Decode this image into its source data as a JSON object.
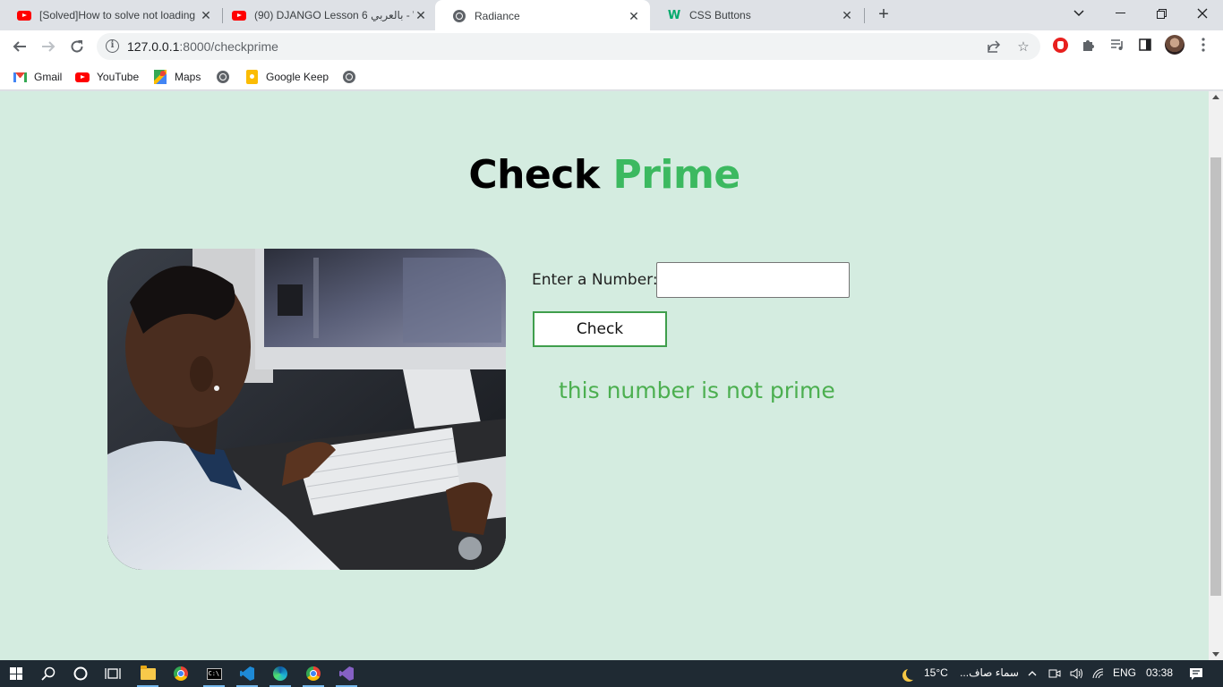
{
  "browser": {
    "tabs": [
      {
        "title": "[Solved]How to solve not loading",
        "favicon": "youtube-icon",
        "active": false
      },
      {
        "title": "(90) DJANGO Lesson 6 بالعربي - \\",
        "favicon": "youtube-icon",
        "active": false
      },
      {
        "title": "Radiance",
        "favicon": "globe-icon",
        "active": true
      },
      {
        "title": "CSS Buttons",
        "favicon": "w3schools-icon",
        "active": false
      }
    ],
    "new_tab_label": "+",
    "url_host": "127.0.0.1",
    "url_path": ":8000/checkprime",
    "bookmarks": [
      {
        "label": "Gmail",
        "icon": "gmail-icon"
      },
      {
        "label": "YouTube",
        "icon": "youtube-icon"
      },
      {
        "label": "Maps",
        "icon": "maps-icon"
      },
      {
        "label": "",
        "icon": "globe-icon"
      },
      {
        "label": "Google Keep",
        "icon": "keep-icon"
      },
      {
        "label": "",
        "icon": "globe-icon"
      }
    ]
  },
  "page": {
    "title_part1": "Check",
    "title_part2": "Prime",
    "title_accent_color": "#3cb960",
    "input_label": "Enter a Number:",
    "input_value": "",
    "button_label": "Check",
    "result_text": "this number is not prime",
    "result_color": "#4caf50",
    "background_color": "#d4ece0"
  },
  "taskbar": {
    "weather_temp": "15°C",
    "weather_text": "سماء صاف...",
    "language": "ENG",
    "time": "03:38"
  }
}
